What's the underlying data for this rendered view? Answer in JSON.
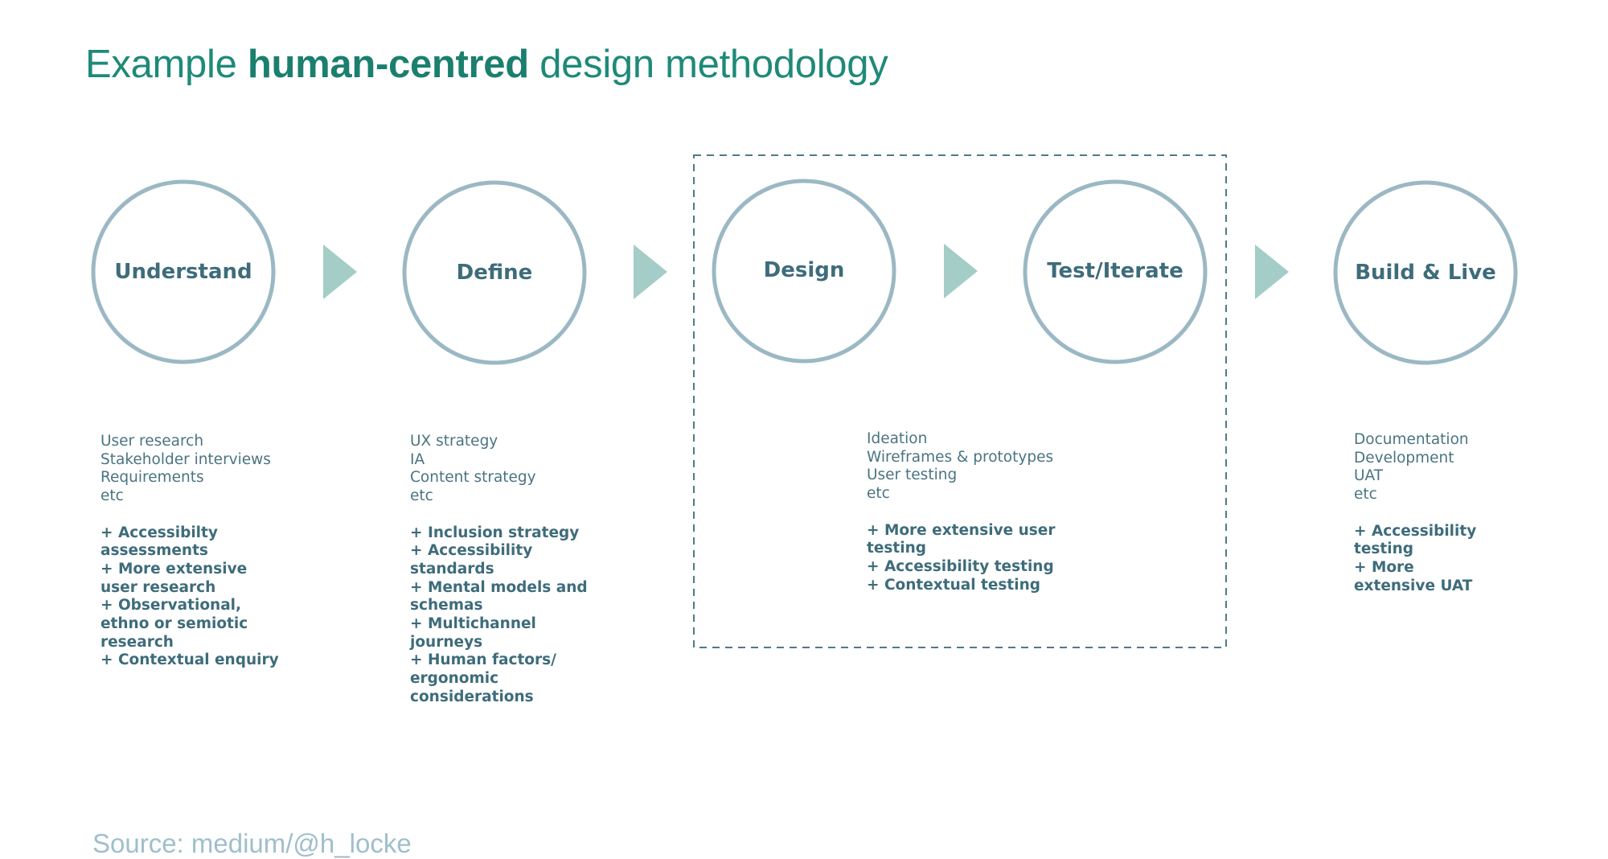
{
  "title": {
    "prefix": "Example ",
    "emphasis": "human-centred",
    "suffix": " design methodology"
  },
  "colors": {
    "title": "#1e8a78",
    "circle_stroke": "#9bb8c4",
    "arrow_fill": "#a3cdc6",
    "label_text": "#3e6c7b",
    "dashed_box": "#4f7a88",
    "source_text": "#9fbfcb"
  },
  "stages": [
    {
      "name": "Understand",
      "activities": [
        "User research",
        "Stakeholder interviews",
        "Requirements",
        "etc"
      ],
      "additions": [
        "+ Accessibilty",
        "assessments",
        "+ More extensive",
        "user research",
        "+ Observational,",
        "ethno or semiotic",
        "research",
        "+ Contextual enquiry"
      ]
    },
    {
      "name": "Define",
      "activities": [
        "UX strategy",
        "IA",
        "Content strategy",
        "etc"
      ],
      "additions": [
        "+ Inclusion strategy",
        "+ Accessibility",
        "standards",
        "+ Mental models and",
        "schemas",
        "+ Multichannel",
        "journeys",
        "+ Human factors/",
        "ergonomic",
        "considerations"
      ]
    },
    {
      "name": "Design",
      "activities": [
        "Ideation",
        "Wireframes & prototypes",
        "User testing",
        "etc"
      ],
      "additions": [
        "+ More extensive user",
        "testing",
        "+ Accessibility testing",
        "+ Contextual testing"
      ]
    },
    {
      "name": "Test/Iterate",
      "activities": [],
      "additions": []
    },
    {
      "name": "Build & Live",
      "activities": [
        "Documentation",
        "Development",
        "UAT",
        "etc"
      ],
      "additions": [
        "+ Accessibility",
        "testing",
        "+ More",
        "extensive UAT"
      ]
    }
  ],
  "grouping": {
    "grouped_stages": [
      "Design",
      "Test/Iterate"
    ],
    "style": "dashed"
  },
  "source": "Source: medium/@h_locke"
}
